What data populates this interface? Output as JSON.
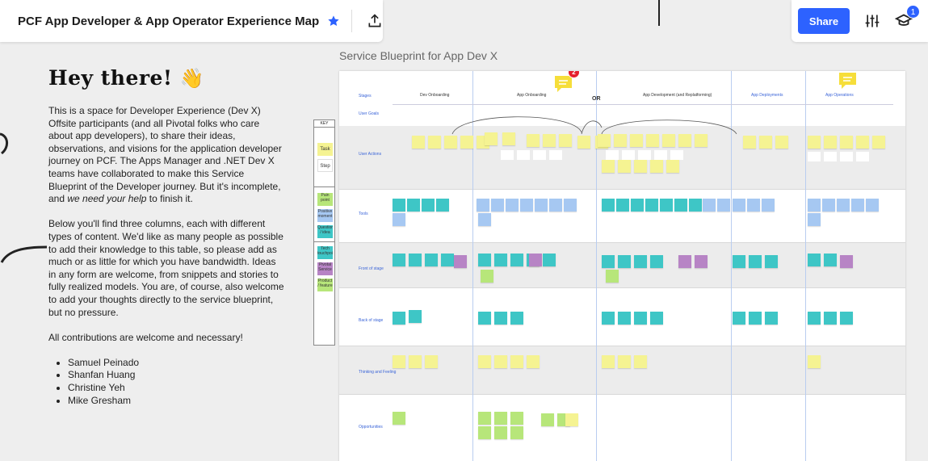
{
  "board": {
    "title": "PCF App Developer & App Operator Experience Map"
  },
  "toolbar": {
    "share_label": "Share",
    "notification_count": "1"
  },
  "intro": {
    "heading": "Hey there!",
    "wave_emoji": "👋",
    "p1_a": "This is a space for Developer Experience (Dev X) Offsite participants (and all Pivotal folks who care about app developers), to share their ideas, observations, and visions for the application developer journey on PCF. The Apps Manager and .NET Dev X teams have collaborated to make this Service Blueprint of the Developer journey. But it's incomplete, and ",
    "p1_em": "we need your help",
    "p1_b": " to finish it.",
    "p2": "Below you'll find three columns, each with different types of content. We'd like as many people as possible to add their knowledge to this table, so please add as much or as little for which you have bandwidth. Ideas in any form are welcome, from snippets and stories to fully realized models. You are, of course, also welcome to add your thoughts directly to the service blueprint, but no pressure.",
    "p3": "All contributions are welcome and necessary!",
    "contributors": [
      "Samuel Peinado",
      "Shanfan Huang",
      "Christine Yeh",
      "Mike Gresham"
    ]
  },
  "blueprint": {
    "title": "Service Blueprint for App Dev X",
    "comment_count": "2",
    "or_label": "OR",
    "key": {
      "title": "KEY",
      "items": [
        "Task",
        "Step",
        "Pain point",
        "Positive moment",
        "Question / idea",
        "Tech touchpoint",
        "Pivotal Service",
        "Product / feature"
      ]
    },
    "phases": [
      "Dev Onboarding",
      "App Onboarding",
      "App Development (and Replatforming)",
      "App Deployments",
      "App Operations"
    ],
    "rows": [
      "Stages",
      "User Goals",
      "User Actions",
      "Tools",
      "Front of stage",
      "Back of stage",
      "Thinking and Feeling",
      "Opportunities"
    ],
    "colors": {
      "yellow": "#f5f392",
      "teal": "#3ec6c6",
      "blue": "#a6c8f2",
      "green": "#b7e67a",
      "purple": "#b784c5",
      "pink": "#f7b0c3",
      "accent": "#2d62ff"
    }
  }
}
